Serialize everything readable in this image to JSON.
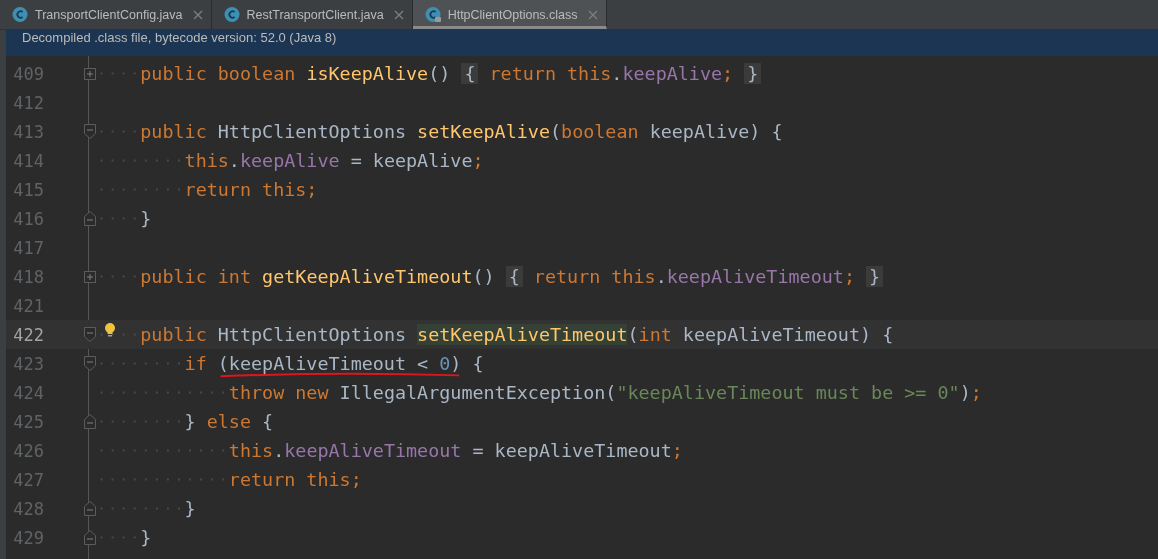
{
  "tabs": [
    {
      "label": "TransportClientConfig.java",
      "selected": false,
      "locked": false
    },
    {
      "label": "RestTransportClient.java",
      "selected": false,
      "locked": false
    },
    {
      "label": "HttpClientOptions.class",
      "selected": true,
      "locked": true
    }
  ],
  "banner": "Decompiled .class file, bytecode version: 52.0 (Java 8)",
  "lines": [
    {
      "number": "409",
      "kind": "folded",
      "tokens": [
        {
          "kind": "kw",
          "t": "public "
        },
        {
          "kind": "kw",
          "t": "boolean "
        },
        {
          "kind": "fn",
          "t": "isKeepAlive"
        },
        {
          "kind": "p",
          "t": "() "
        },
        {
          "kind": "fb",
          "t": "{"
        },
        {
          "kind": "kw",
          "t": " return "
        },
        {
          "kind": "kw",
          "t": "this"
        },
        {
          "kind": "p",
          "t": "."
        },
        {
          "kind": "field",
          "t": "keepAlive"
        },
        {
          "kind": "kw",
          "t": "; "
        },
        {
          "kind": "fb",
          "t": "}"
        }
      ]
    },
    {
      "number": "412"
    },
    {
      "number": "413",
      "kind": "opener",
      "tokens": [
        {
          "kind": "kw",
          "t": "public "
        },
        {
          "kind": "p",
          "t": "HttpClientOptions "
        },
        {
          "kind": "fn",
          "t": "setKeepAlive"
        },
        {
          "kind": "p",
          "t": "("
        },
        {
          "kind": "kw",
          "t": "boolean "
        },
        {
          "kind": "p",
          "t": "keepAlive) {"
        }
      ],
      "children": [
        {
          "number": "414",
          "tokens": [
            {
              "kind": "kw",
              "t": "this"
            },
            {
              "kind": "p",
              "t": "."
            },
            {
              "kind": "field",
              "t": "keepAlive"
            },
            {
              "kind": "p",
              "t": " = keepAlive"
            },
            {
              "kind": "kw",
              "t": ";"
            }
          ]
        },
        {
          "number": "415",
          "tokens": [
            {
              "kind": "kw",
              "t": "return this;"
            }
          ]
        }
      ]
    },
    {
      "number": "416",
      "kind": "closer",
      "tokens": [
        {
          "kind": "p",
          "t": "}"
        }
      ]
    },
    {
      "number": "417"
    },
    {
      "number": "418",
      "kind": "folded",
      "tokens": [
        {
          "kind": "kw",
          "t": "public "
        },
        {
          "kind": "kw",
          "t": "int "
        },
        {
          "kind": "fn",
          "t": "getKeepAliveTimeout"
        },
        {
          "kind": "p",
          "t": "() "
        },
        {
          "kind": "fb",
          "t": "{"
        },
        {
          "kind": "kw",
          "t": " return "
        },
        {
          "kind": "kw",
          "t": "this"
        },
        {
          "kind": "p",
          "t": "."
        },
        {
          "kind": "field",
          "t": "keepAliveTimeout"
        },
        {
          "kind": "kw",
          "t": "; "
        },
        {
          "kind": "fb",
          "t": "}"
        }
      ]
    },
    {
      "number": "421"
    },
    {
      "number": "422",
      "kind": "opener",
      "current": true,
      "bulb": true,
      "tokens": [
        {
          "kind": "kw",
          "t": "public "
        },
        {
          "kind": "p",
          "t": "HttpClientOptions "
        },
        {
          "kind": "fn",
          "t": "setKeepAliveTimeout",
          "highlighted": true
        },
        {
          "kind": "p",
          "t": "("
        },
        {
          "kind": "kw",
          "t": "int "
        },
        {
          "kind": "p",
          "t": "keepAliveTimeout) {"
        }
      ],
      "children": [
        {
          "number": "423",
          "kind": "opener",
          "tokens": [
            {
              "kind": "kw",
              "t": "if "
            },
            {
              "kind": "group",
              "underlined": true,
              "parts": [
                {
                  "kind": "p",
                  "t": "(keepAliveTimeout < "
                },
                {
                  "kind": "num",
                  "t": "0"
                },
                {
                  "kind": "p",
                  "t": ")"
                }
              ]
            },
            {
              "kind": "p",
              "t": " {"
            }
          ],
          "children": [
            {
              "number": "424",
              "tokens": [
                {
                  "kind": "kw",
                  "t": "throw "
                },
                {
                  "kind": "kw",
                  "t": "new "
                },
                {
                  "kind": "p",
                  "t": "IllegalArgumentException("
                },
                {
                  "kind": "str",
                  "t": "\"keepAliveTimeout must be >= 0\""
                },
                {
                  "kind": "p",
                  "t": ")"
                },
                {
                  "kind": "kw",
                  "t": ";"
                }
              ]
            }
          ]
        },
        {
          "number": "425",
          "kind": "closer",
          "tokens": [
            {
              "kind": "p",
              "t": "} "
            },
            {
              "kind": "kw",
              "t": "else "
            },
            {
              "kind": "p",
              "t": "{"
            }
          ],
          "children": [
            {
              "number": "426",
              "tokens": [
                {
                  "kind": "kw",
                  "t": "this"
                },
                {
                  "kind": "p",
                  "t": "."
                },
                {
                  "kind": "field",
                  "t": "keepAliveTimeout"
                },
                {
                  "kind": "p",
                  "t": " = keepAliveTimeout"
                },
                {
                  "kind": "kw",
                  "t": ";"
                }
              ]
            },
            {
              "number": "427",
              "tokens": [
                {
                  "kind": "kw",
                  "t": "return this;"
                }
              ]
            }
          ]
        },
        {
          "number": "428",
          "kind": "closer",
          "tokens": [
            {
              "kind": "p",
              "t": "}"
            }
          ]
        }
      ]
    },
    {
      "number": "429",
      "kind": "closer",
      "tokens": [
        {
          "kind": "p",
          "t": "}"
        }
      ]
    }
  ]
}
